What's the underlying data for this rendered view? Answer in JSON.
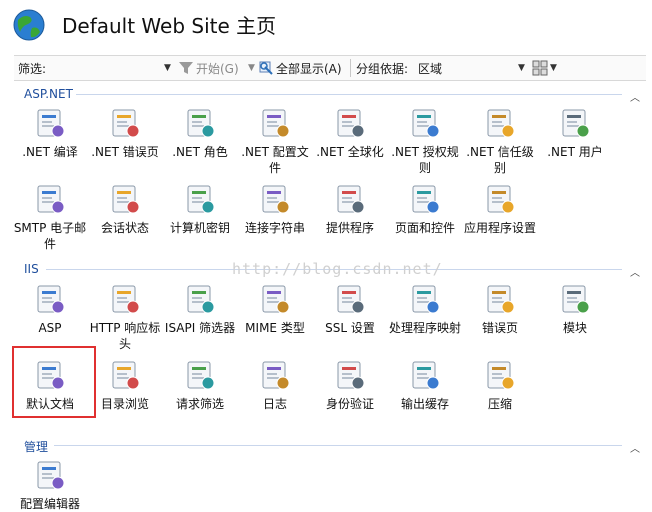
{
  "header": {
    "title": "Default Web Site 主页"
  },
  "toolbar": {
    "filter_label": "筛选:",
    "start_label": "开始(G)",
    "show_all_label": "全部显示(A)",
    "group_label": "分组依据:",
    "group_value": "区域"
  },
  "sections": {
    "aspnet": {
      "title": "ASP.NET"
    },
    "iis": {
      "title": "IIS"
    },
    "manage": {
      "title": "管理"
    }
  },
  "aspnet_items": [
    {
      "label": ".NET 编译",
      "icon": "net-compile-icon"
    },
    {
      "label": ".NET 错误页",
      "icon": "net-error-page-icon"
    },
    {
      "label": ".NET 角色",
      "icon": "net-roles-icon"
    },
    {
      "label": ".NET 配置文件",
      "icon": "net-profile-icon"
    },
    {
      "label": ".NET 全球化",
      "icon": "net-globalization-icon"
    },
    {
      "label": ".NET 授权规则",
      "icon": "net-authorization-icon"
    },
    {
      "label": ".NET 信任级别",
      "icon": "net-trust-icon"
    },
    {
      "label": ".NET 用户",
      "icon": "net-users-icon"
    },
    {
      "label": "SMTP 电子邮件",
      "icon": "smtp-email-icon"
    },
    {
      "label": "会话状态",
      "icon": "session-state-icon"
    },
    {
      "label": "计算机密钥",
      "icon": "machine-key-icon"
    },
    {
      "label": "连接字符串",
      "icon": "connection-strings-icon"
    },
    {
      "label": "提供程序",
      "icon": "providers-icon"
    },
    {
      "label": "页面和控件",
      "icon": "pages-controls-icon"
    },
    {
      "label": "应用程序设置",
      "icon": "app-settings-icon"
    }
  ],
  "iis_items": [
    {
      "label": "ASP",
      "icon": "asp-icon"
    },
    {
      "label": "HTTP 响应标头",
      "icon": "http-headers-icon"
    },
    {
      "label": "ISAPI 筛选器",
      "icon": "isapi-filters-icon"
    },
    {
      "label": "MIME 类型",
      "icon": "mime-types-icon"
    },
    {
      "label": "SSL 设置",
      "icon": "ssl-settings-icon"
    },
    {
      "label": "处理程序映射",
      "icon": "handler-mappings-icon"
    },
    {
      "label": "错误页",
      "icon": "error-pages-icon"
    },
    {
      "label": "模块",
      "icon": "modules-icon"
    },
    {
      "label": "默认文档",
      "icon": "default-document-icon"
    },
    {
      "label": "目录浏览",
      "icon": "directory-browsing-icon"
    },
    {
      "label": "请求筛选",
      "icon": "request-filtering-icon"
    },
    {
      "label": "日志",
      "icon": "logging-icon"
    },
    {
      "label": "身份验证",
      "icon": "authentication-icon"
    },
    {
      "label": "输出缓存",
      "icon": "output-caching-icon"
    },
    {
      "label": "压缩",
      "icon": "compression-icon"
    }
  ],
  "manage_items": [
    {
      "label": "配置编辑器",
      "icon": "config-editor-icon"
    }
  ],
  "watermark": "http://blog.csdn.net/",
  "colors": {
    "section_title": "#1f4e9c",
    "highlight_border": "#e03030"
  }
}
